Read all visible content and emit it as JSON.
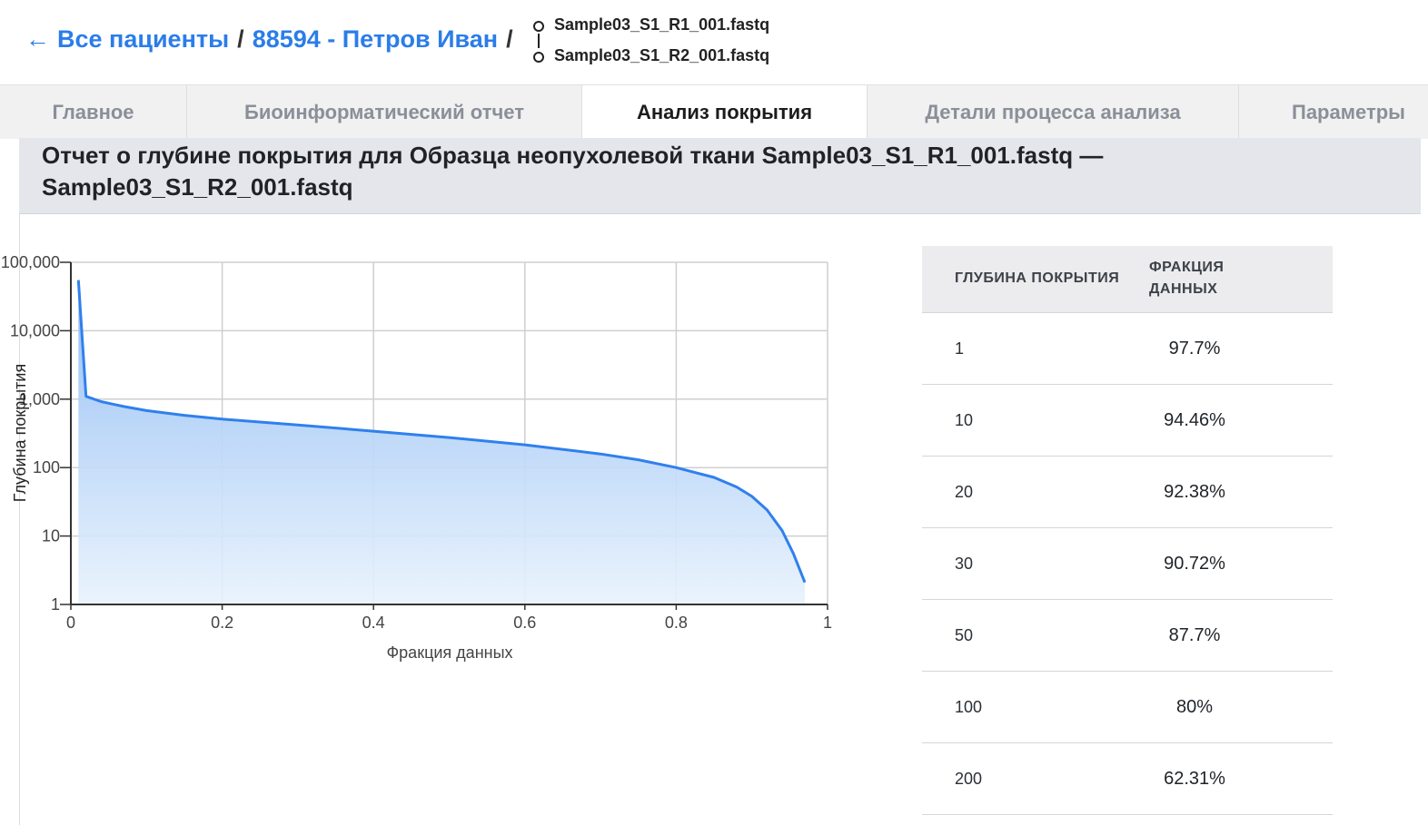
{
  "header": {
    "back_arrow": "←",
    "breadcrumb_all_patients": "Все пациенты",
    "separator": "/",
    "patient": "88594 - Петров Иван",
    "file_r1": "Sample03_S1_R1_001.fastq",
    "file_r2": "Sample03_S1_R2_001.fastq"
  },
  "tabs": [
    {
      "label": "Главное",
      "active": false
    },
    {
      "label": "Биоинформатический отчет",
      "active": false
    },
    {
      "label": "Анализ покрытия",
      "active": true
    },
    {
      "label": "Детали процесса анализа",
      "active": false
    },
    {
      "label": "Параметры",
      "active": false
    }
  ],
  "report": {
    "title": "Отчет о глубине покрытия для Образца неопухолевой ткани Sample03_S1_R1_001.fastq — Sample03_S1_R2_001.fastq"
  },
  "chart_data": {
    "type": "area",
    "xlabel": "Фракция данных",
    "ylabel": "Глубина покрытия",
    "x_ticks": [
      "0",
      "0.2",
      "0.4",
      "0.6",
      "0.8",
      "1"
    ],
    "y_ticks": [
      "1",
      "10",
      "100",
      "1,000",
      "10,000",
      "100,000"
    ],
    "xlim": [
      0,
      1
    ],
    "ylim": [
      1,
      100000
    ],
    "y_scale": "log",
    "grid": true,
    "line_color": "#2f80ed",
    "fill_color": "#9cc4f5",
    "series": [
      {
        "points": [
          [
            0.01,
            55000
          ],
          [
            0.02,
            1100
          ],
          [
            0.04,
            920
          ],
          [
            0.07,
            780
          ],
          [
            0.1,
            680
          ],
          [
            0.15,
            580
          ],
          [
            0.2,
            510
          ],
          [
            0.3,
            420
          ],
          [
            0.4,
            340
          ],
          [
            0.5,
            275
          ],
          [
            0.6,
            215
          ],
          [
            0.7,
            158
          ],
          [
            0.75,
            130
          ],
          [
            0.8,
            100
          ],
          [
            0.85,
            72
          ],
          [
            0.88,
            52
          ],
          [
            0.9,
            38
          ],
          [
            0.92,
            24
          ],
          [
            0.94,
            12
          ],
          [
            0.955,
            5.5
          ],
          [
            0.97,
            2.1
          ]
        ]
      }
    ]
  },
  "coverage_table": {
    "header_depth": "ГЛУБИНА ПОКРЫТИЯ",
    "header_fraction": "ФРАКЦИЯ ДАННЫХ",
    "rows": [
      {
        "depth": "1",
        "fraction": "97.7%"
      },
      {
        "depth": "10",
        "fraction": "94.46%"
      },
      {
        "depth": "20",
        "fraction": "92.38%"
      },
      {
        "depth": "30",
        "fraction": "90.72%"
      },
      {
        "depth": "50",
        "fraction": "87.7%"
      },
      {
        "depth": "100",
        "fraction": "80%"
      },
      {
        "depth": "200",
        "fraction": "62.31%"
      }
    ]
  }
}
